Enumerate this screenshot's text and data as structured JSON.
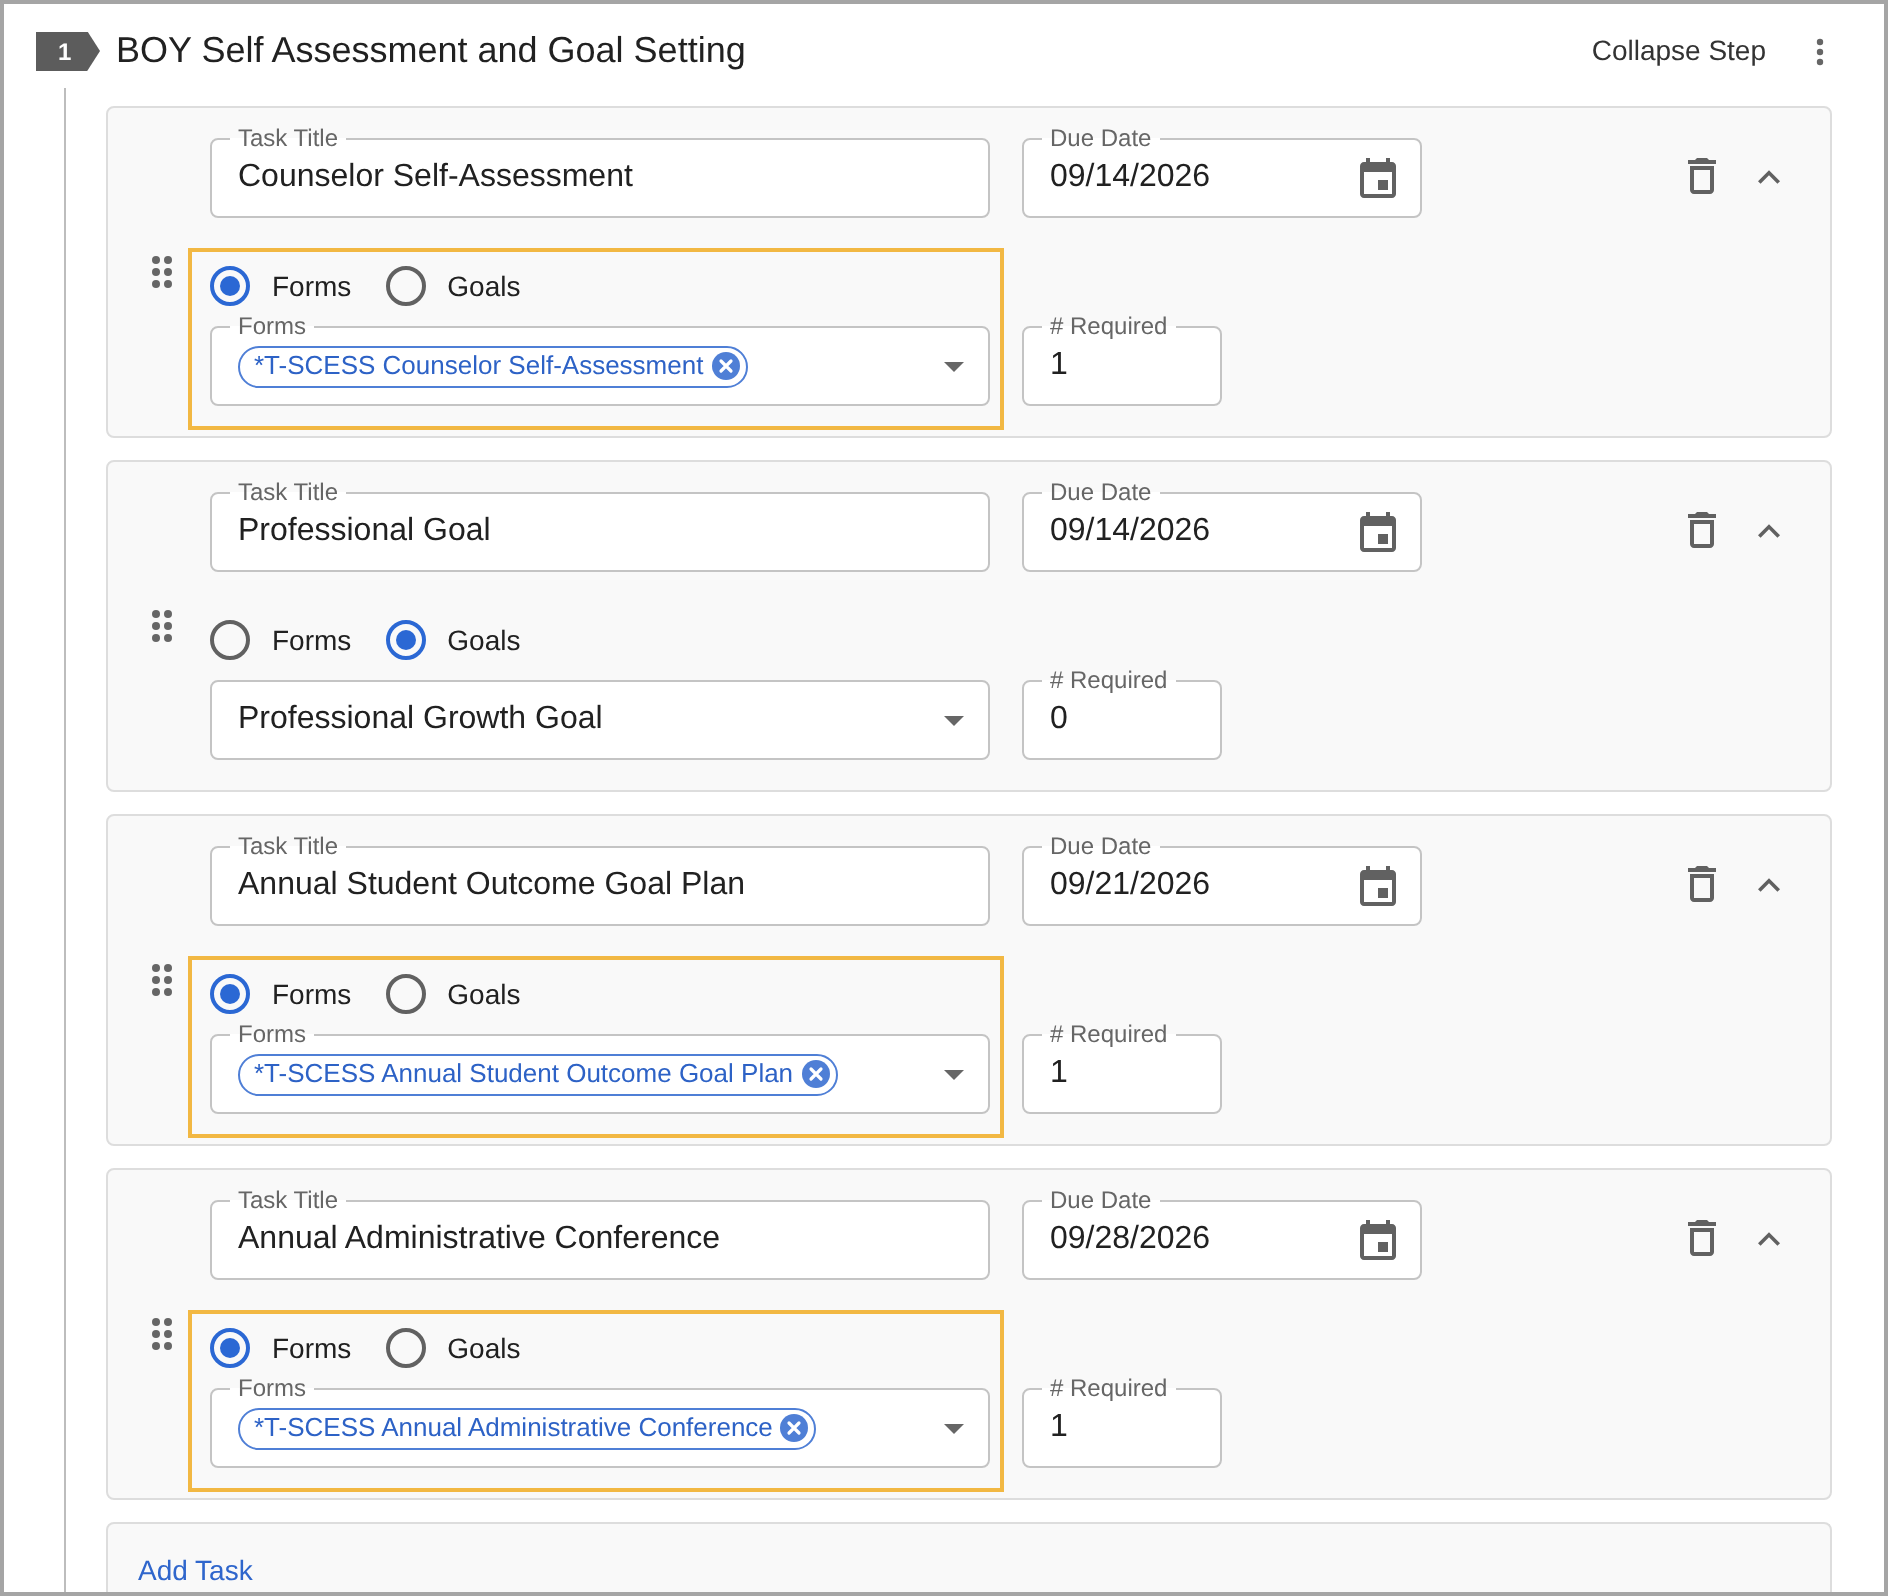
{
  "step": {
    "number": "1",
    "title": "BOY Self Assessment and Goal Setting",
    "collapse_label": "Collapse Step"
  },
  "tasks": [
    {
      "title_label": "Task Title",
      "title": "Counselor Self-Assessment",
      "due_label": "Due Date",
      "due": "09/14/2026",
      "highlighted": true,
      "options": [
        {
          "label": "Forms",
          "selected": true
        },
        {
          "label": "Goals",
          "selected": false
        }
      ],
      "picker": {
        "label": "Forms",
        "chips": [
          "*T-SCESS Counselor Self-Assessment"
        ]
      },
      "required_label": "# Required",
      "required": "1"
    },
    {
      "title_label": "Task Title",
      "title": "Professional Goal",
      "due_label": "Due Date",
      "due": "09/14/2026",
      "highlighted": false,
      "options": [
        {
          "label": "Forms",
          "selected": false
        },
        {
          "label": "Goals",
          "selected": true
        }
      ],
      "picker": {
        "value": "Professional Growth Goal"
      },
      "required_label": "# Required",
      "required": "0"
    },
    {
      "title_label": "Task Title",
      "title": "Annual Student Outcome Goal Plan",
      "due_label": "Due Date",
      "due": "09/21/2026",
      "highlighted": true,
      "options": [
        {
          "label": "Forms",
          "selected": true
        },
        {
          "label": "Goals",
          "selected": false
        }
      ],
      "picker": {
        "label": "Forms",
        "chips": [
          "*T-SCESS Annual Student Outcome Goal Plan"
        ]
      },
      "required_label": "# Required",
      "required": "1"
    },
    {
      "title_label": "Task Title",
      "title": "Annual Administrative Conference",
      "due_label": "Due Date",
      "due": "09/28/2026",
      "highlighted": true,
      "options": [
        {
          "label": "Forms",
          "selected": true
        },
        {
          "label": "Goals",
          "selected": false
        }
      ],
      "picker": {
        "label": "Forms",
        "chips": [
          "*T-SCESS Annual Administrative Conference"
        ]
      },
      "required_label": "# Required",
      "required": "1"
    }
  ],
  "add_task": "Add Task"
}
